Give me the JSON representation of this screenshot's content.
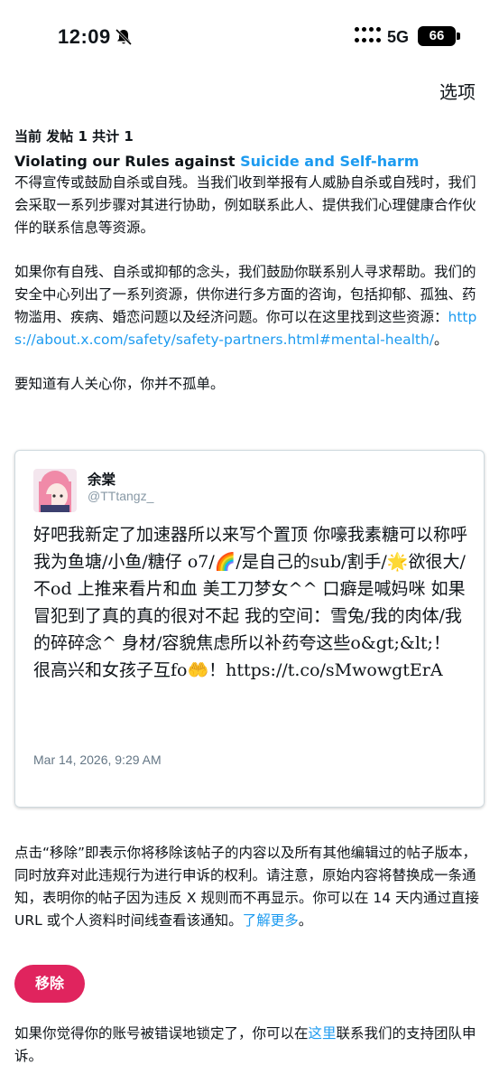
{
  "status_bar": {
    "time": "12:09",
    "network": "5G",
    "battery": "66",
    "icons": [
      "bell-muted-icon",
      "signal-icon",
      "battery-icon"
    ]
  },
  "header": {
    "options_label": "选项"
  },
  "notice": {
    "post_count": "当前 发帖 1 共计 1",
    "rule_title_prefix": "Violating our Rules against ",
    "rule_title_link": "Suicide and Self-harm",
    "para1": "不得宣传或鼓励自杀或自残。当我们收到举报有人威胁自杀或自残时，我们会采取一系列步骤对其进行协助，例如联系此人、提供我们心理健康合作伙伴的联系信息等资源。",
    "para2_text": "如果你有自残、自杀或抑郁的念头，我们鼓励你联系别人寻求帮助。我们的安全中心列出了一系列资源，供你进行多方面的咨询，包括抑郁、孤独、药物滥用、疾病、婚恋问题以及经济问题。你可以在这里找到这些资源：",
    "para2_link": "https://about.x.com/safety/safety-partners.html#mental-health/",
    "para2_end": "。",
    "para3": "要知道有人关心你，你并不孤单。"
  },
  "tweet": {
    "author_name": "余棠",
    "author_handle": "@TTtangz_",
    "text": "好吧我新定了加速器所以来写个置顶 你嚎我素糖可以称呼我为鱼塘/小鱼/糖仔 o7/🌈/是自己的sub/割手/🌟欲很大/不od 上推来看片和血 美工刀梦女^^ 口癖是喊妈咪 如果冒犯到了真的真的很对不起 我的空间：雪兔/我的肉体/我的碎碎念^ 身材/容貌焦虑所以补药夸这些o&gt;&lt;！ 很高兴和女孩子互fo🤲！https://t.co/sMwowgtErA",
    "timestamp": "Mar 14, 2026, 9:29 AM"
  },
  "removal": {
    "notice_text": "点击“移除”即表示你将移除该帖子的内容以及所有其他编辑过的帖子版本，同时放弃对此违规行为进行申诉的权利。请注意，原始内容将替换成一条通知，表明你的帖子因为违反 X 规则而不再显示。你可以在 14 天内通过直接 URL 或个人资料时间线查看该通知。",
    "learn_more_link": "了解更多",
    "notice_end": "。",
    "button_label": "移除",
    "appeal_prefix": "如果你觉得你的账号被错误地锁定了，你可以在",
    "appeal_link": "这里",
    "appeal_suffix": "联系我们的支持团队申诉。"
  },
  "colors": {
    "link": "#1d9bf0",
    "remove_button": "#e0245e",
    "text": "#0f1419",
    "muted": "#657786"
  }
}
